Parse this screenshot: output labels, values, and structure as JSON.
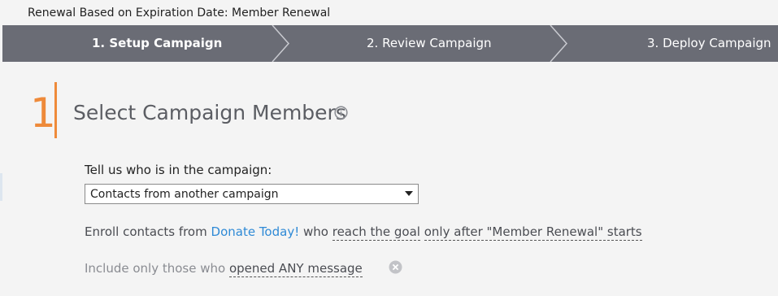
{
  "header": {
    "title": "Renewal Based on Expiration Date: Member Renewal"
  },
  "wizard": {
    "steps": [
      {
        "label": "1. Setup Campaign",
        "active": true
      },
      {
        "label": "2. Review Campaign",
        "active": false
      },
      {
        "label": "3. Deploy Campaign",
        "active": false
      }
    ]
  },
  "section": {
    "number": "1",
    "title": "Select Campaign Members",
    "info_icon": "info-icon"
  },
  "members": {
    "who_label": "Tell us who is in the campaign:",
    "select_value": "Contacts from another campaign",
    "enroll_prefix": "Enroll contacts from",
    "source_campaign": "Donate Today!",
    "who_word": "who",
    "condition": "reach the goal",
    "timing": "only after \"Member Renewal\" starts",
    "include_prefix": "Include only those who",
    "include_filter": "opened ANY message",
    "remove_icon": "close-circle-icon"
  },
  "colors": {
    "wizard_bg": "#6a6c75",
    "accent": "#ee8a3a",
    "link": "#2f8ad6",
    "page_bg": "#f4f4f4"
  }
}
